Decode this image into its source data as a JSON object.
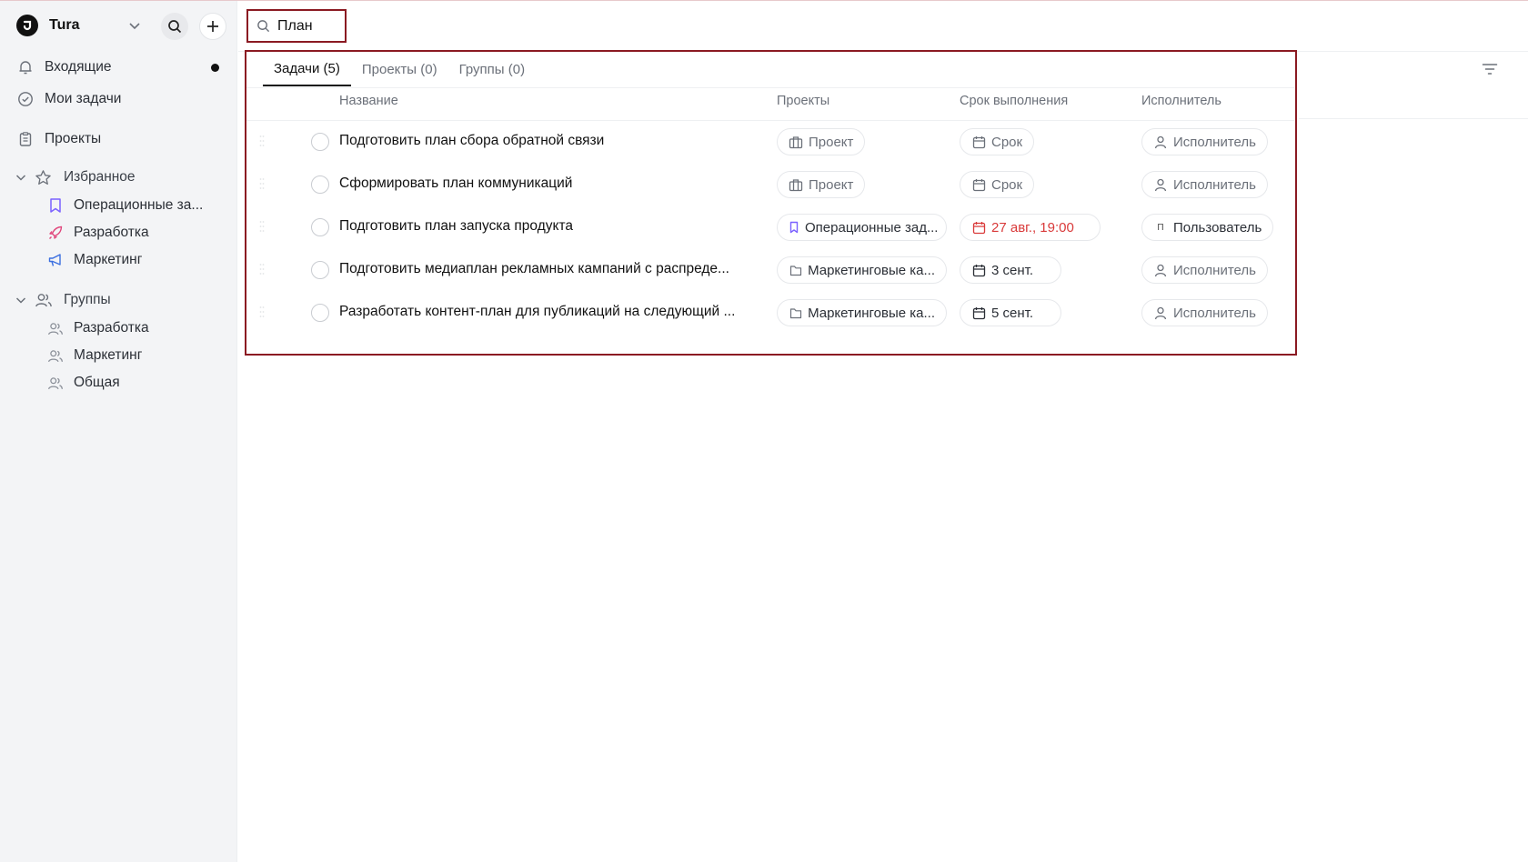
{
  "workspace": {
    "name": "Tura"
  },
  "sidebar": {
    "nav": [
      {
        "label": "Входящие"
      },
      {
        "label": "Мои задачи"
      },
      {
        "label": "Проекты"
      }
    ],
    "favorites": {
      "label": "Избранное",
      "items": [
        {
          "label": "Операционные за...",
          "icon": "bookmark-icon",
          "color": "#7b61ff"
        },
        {
          "label": "Разработка",
          "icon": "rocket-icon",
          "color": "#e0457b"
        },
        {
          "label": "Маркетинг",
          "icon": "megaphone-icon",
          "color": "#3b6fe0"
        }
      ]
    },
    "groups": {
      "label": "Группы",
      "items": [
        {
          "label": "Разработка"
        },
        {
          "label": "Маркетинг"
        },
        {
          "label": "Общая"
        }
      ]
    }
  },
  "search": {
    "value": "План"
  },
  "tabs": [
    {
      "label": "Задачи (5)",
      "active": true
    },
    {
      "label": "Проекты (0)",
      "active": false
    },
    {
      "label": "Группы (0)",
      "active": false
    }
  ],
  "columns": {
    "name": "Название",
    "projects": "Проекты",
    "due": "Срок выполнения",
    "assignee": "Исполнитель"
  },
  "tasks": [
    {
      "title": "Подготовить план сбора обратной связи",
      "project": "Проект",
      "due": "Срок",
      "assignee": "Исполнитель"
    },
    {
      "title": "Сформировать план коммуникаций",
      "project": "Проект",
      "due": "Срок",
      "assignee": "Исполнитель"
    },
    {
      "title": "Подготовить план запуска продукта",
      "project": "Операционные зад...",
      "due": "27 авг., 19:00",
      "assignee": "Пользователь",
      "assignee_initial": "П"
    },
    {
      "title": "Подготовить медиаплан рекламных кампаний с распреде...",
      "project": "Маркетинговые ка...",
      "due": "3 сент.",
      "assignee": "Исполнитель"
    },
    {
      "title": "Разработать контент-план для публикаций на следующий ...",
      "project": "Маркетинговые ка...",
      "due": "5 сент.",
      "assignee": "Исполнитель"
    }
  ],
  "colors": {
    "highlight_border": "#8b1a22",
    "overdue": "#d93a3a",
    "sidebar_bg": "#f3f4f6"
  }
}
